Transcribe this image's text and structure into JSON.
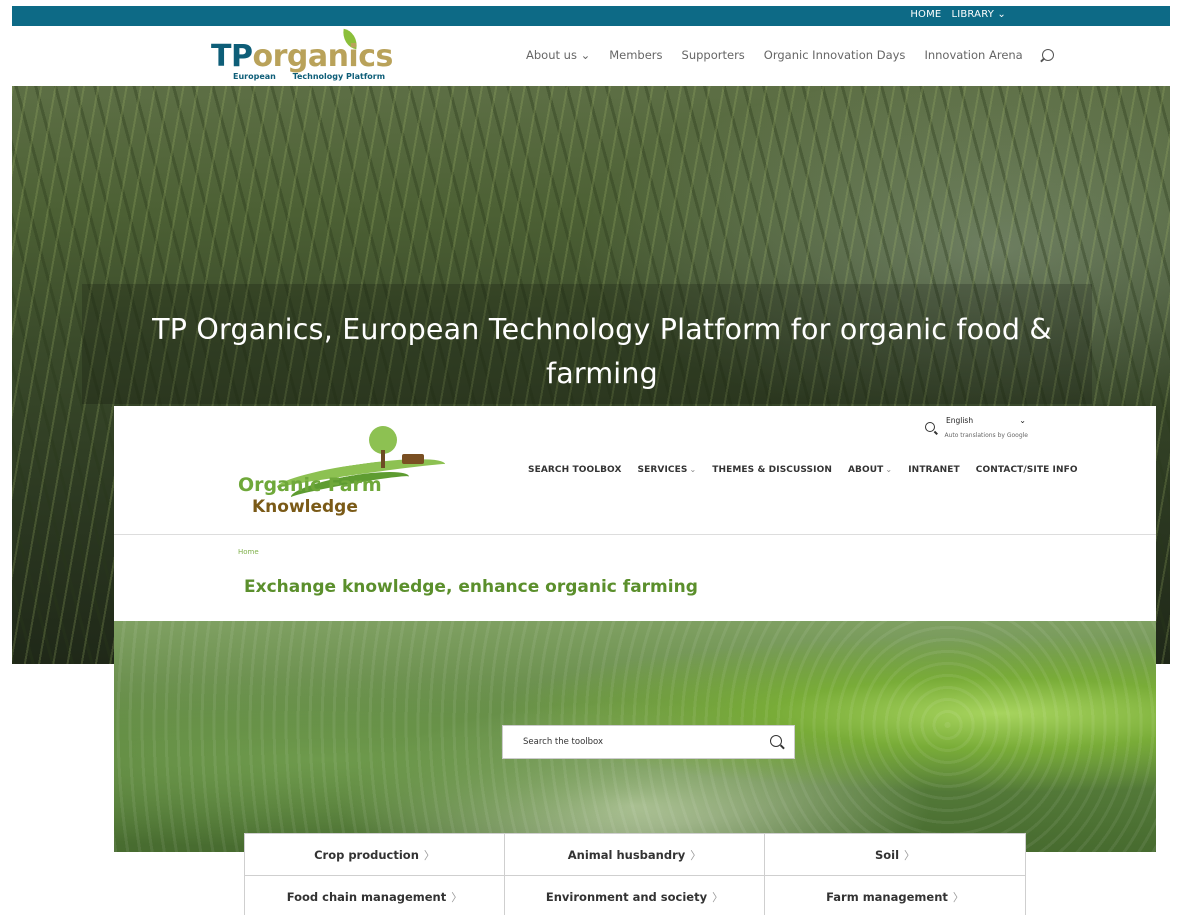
{
  "tp_site": {
    "topbar": {
      "home": "HOME",
      "library": "LIBRARY ⌄"
    },
    "logo": {
      "tp": "TP",
      "organics": "organics",
      "tagline_left": "European",
      "tagline_right": "Technology Platform"
    },
    "nav": [
      {
        "label": "About us ⌄"
      },
      {
        "label": "Members"
      },
      {
        "label": "Supporters"
      },
      {
        "label": "Organic Innovation Days"
      },
      {
        "label": "Innovation Arena"
      }
    ],
    "hero_title": "TP Organics, European Technology Platform for organic food & farming"
  },
  "ofk_site": {
    "logo": {
      "line1": "Organic Farm",
      "line2": "Knowledge"
    },
    "language": {
      "selected": "English",
      "note": "Auto translations by Google"
    },
    "nav": [
      {
        "label": "SEARCH TOOLBOX",
        "caret": ""
      },
      {
        "label": "SERVICES",
        "caret": "⌄"
      },
      {
        "label": "THEMES & DISCUSSION",
        "caret": ""
      },
      {
        "label": "ABOUT",
        "caret": "⌄"
      },
      {
        "label": "INTRANET",
        "caret": ""
      },
      {
        "label": "CONTACT/SITE INFO",
        "caret": ""
      }
    ],
    "breadcrumb": "Home",
    "page_title": "Exchange knowledge, enhance organic farming",
    "search": {
      "placeholder": "Search the toolbox"
    },
    "categories": [
      {
        "label": "Crop production",
        "arrow": "〉"
      },
      {
        "label": "Animal husbandry",
        "arrow": "〉"
      },
      {
        "label": "Soil",
        "arrow": "〉"
      },
      {
        "label": "Food chain management",
        "arrow": "〉"
      },
      {
        "label": "Environment and society",
        "arrow": "〉"
      },
      {
        "label": "Farm management",
        "arrow": "〉"
      }
    ]
  },
  "colors": {
    "tp_topbar": "#0d6a86",
    "tp_brand_blue": "#0e5e78",
    "tp_brand_gold": "#b9a25a",
    "ofk_green": "#5b8f2c",
    "ofk_brown": "#7a5a17"
  }
}
